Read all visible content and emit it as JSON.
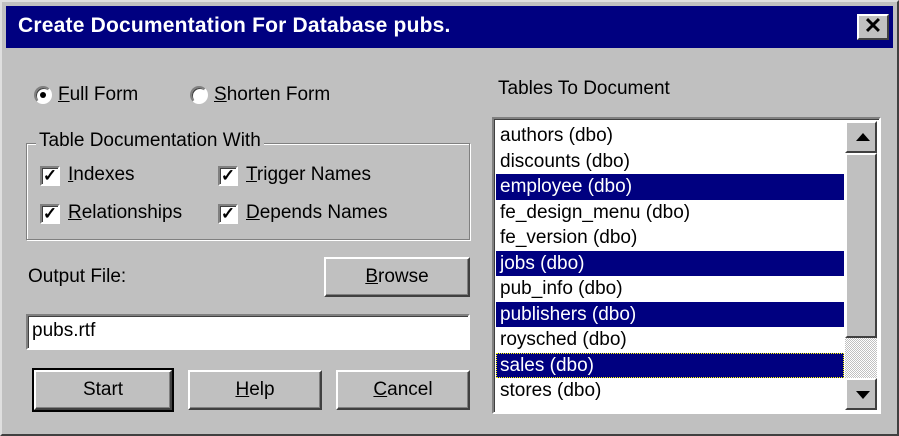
{
  "window": {
    "title": "Create Documentation For Database pubs.",
    "close_glyph": "✕"
  },
  "form_type": {
    "full_label_first": "F",
    "full_label_rest": "ull Form",
    "short_label_first": "S",
    "short_label_rest": "horten Form",
    "selected": "full"
  },
  "table_doc": {
    "group_title": "Table Documentation With",
    "indexes_first": "I",
    "indexes_rest": "ndexes",
    "trigger_first": "T",
    "trigger_rest": "rigger Names",
    "relationships_first": "R",
    "relationships_rest": "elationships",
    "depends_first": "D",
    "depends_rest": "epends Names",
    "check_glyph": "✓"
  },
  "output": {
    "label": "Output File:",
    "browse_first": "B",
    "browse_rest": "rowse",
    "value": "pubs.rtf"
  },
  "buttons": {
    "start": "Start",
    "help_first": "H",
    "help_rest": "elp",
    "cancel_first": "C",
    "cancel_rest": "ancel"
  },
  "tables": {
    "label": "Tables To Document",
    "items": [
      {
        "label": "authors (dbo)",
        "selected": false
      },
      {
        "label": "discounts (dbo)",
        "selected": false
      },
      {
        "label": "employee (dbo)",
        "selected": true
      },
      {
        "label": "fe_design_menu (dbo)",
        "selected": false
      },
      {
        "label": "fe_version (dbo)",
        "selected": false
      },
      {
        "label": "jobs (dbo)",
        "selected": true
      },
      {
        "label": "pub_info (dbo)",
        "selected": false
      },
      {
        "label": "publishers (dbo)",
        "selected": true
      },
      {
        "label": "roysched (dbo)",
        "selected": false
      },
      {
        "label": "sales (dbo)",
        "selected": true
      },
      {
        "label": "stores (dbo)",
        "selected": false
      }
    ]
  },
  "colors": {
    "title_bar": "#000080",
    "selection": "#000080",
    "face": "#c0c0c0"
  }
}
